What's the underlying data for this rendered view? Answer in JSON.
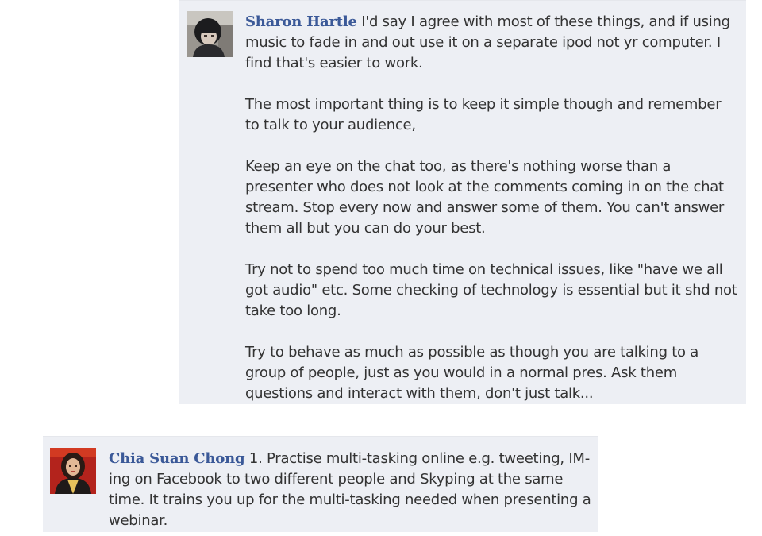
{
  "comments": [
    {
      "author": "Sharon Hartle",
      "paragraphs": [
        "I'd say I agree with most of these things, and if using music to fade in and out use it on a separate ipod not yr computer. I find that's easier to work.",
        "The most important thing is to keep it simple though and remember to talk to your audience,",
        "Keep an eye on the chat too, as there's nothing worse than a presenter who does not look at the comments coming in on the chat stream. Stop every now and answer some of them. You can't answer them all but you can do your best.",
        "Try not to spend too much time on technical issues, like \"have we all got audio\" etc. Some checking of technology is essential but it shd not take too long.",
        "Try to behave as much as possible as though you are talking to a group of people, just as you would in a normal pres. Ask them questions and interact with them, don't just talk..."
      ]
    },
    {
      "author": "Chia Suan Chong",
      "paragraphs": [
        "1. Practise multi-tasking online e.g. tweeting, IM-ing on Facebook to two different people and Skyping at the same time. It trains you up for the multi-tasking needed when presenting a webinar."
      ]
    }
  ],
  "colors": {
    "comment_background": "#edeff4",
    "author_link": "#3b5998",
    "body_text": "#333333"
  }
}
